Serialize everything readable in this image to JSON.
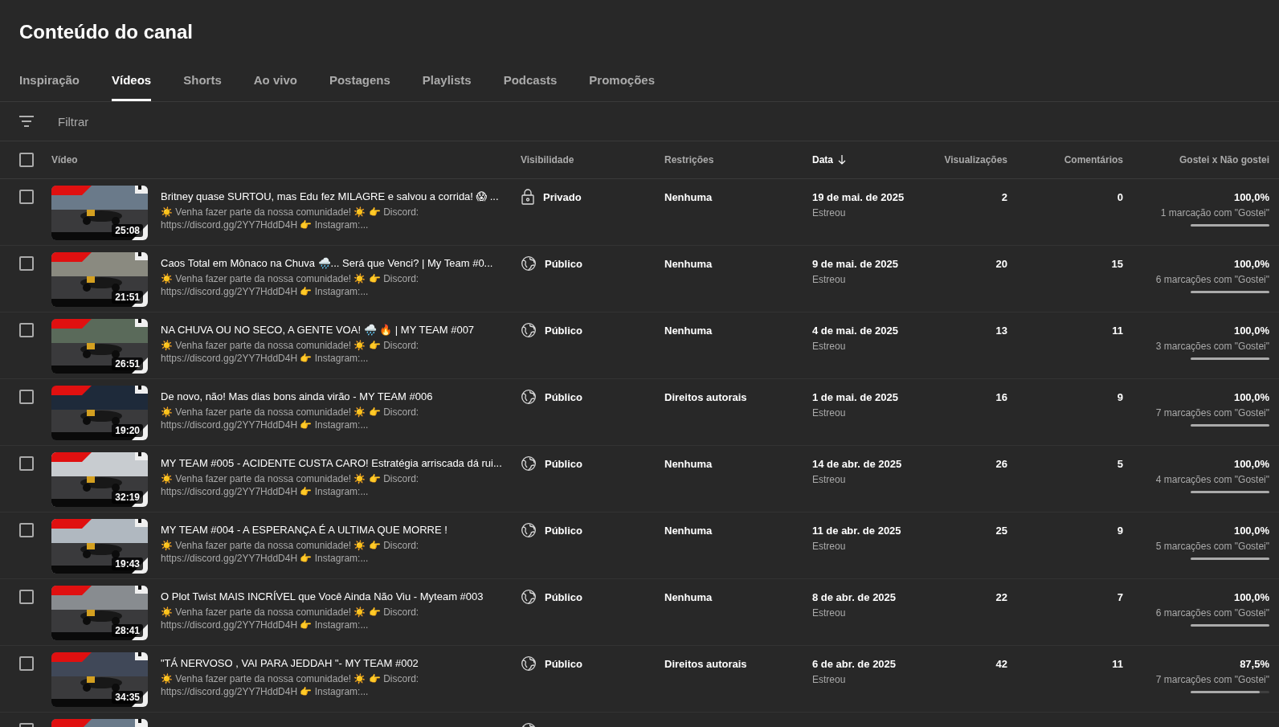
{
  "page_title": "Conteúdo do canal",
  "tabs": [
    {
      "label": "Inspiração",
      "selected": false
    },
    {
      "label": "Vídeos",
      "selected": true
    },
    {
      "label": "Shorts",
      "selected": false
    },
    {
      "label": "Ao vivo",
      "selected": false
    },
    {
      "label": "Postagens",
      "selected": false
    },
    {
      "label": "Playlists",
      "selected": false
    },
    {
      "label": "Podcasts",
      "selected": false
    },
    {
      "label": "Promoções",
      "selected": false
    }
  ],
  "filter": {
    "placeholder": "Filtrar"
  },
  "table": {
    "select_all_checked": false,
    "columns": [
      {
        "label": "Vídeo",
        "sorted": false
      },
      {
        "label": "Visibilidade",
        "sorted": false
      },
      {
        "label": "Restrições",
        "sorted": false
      },
      {
        "label": "Data",
        "sorted": true
      },
      {
        "label": "Visualizações",
        "sorted": false
      },
      {
        "label": "Comentários",
        "sorted": false
      },
      {
        "label": "Gostei x Não gostei",
        "sorted": false
      }
    ],
    "rows": [
      {
        "checked": false,
        "duration": "25:08",
        "title": "Britney quase SURTOU, mas Edu fez MILAGRE e salvou a corrida! 😱 ...",
        "description": "☀️ Venha fazer parte da nossa comunidade! ☀️ 👉 Discord: https://discord.gg/2YY7HddD4H 👉 Instagram:...",
        "visibility": {
          "kind": "private",
          "label": "Privado"
        },
        "restrictions": "Nenhuma",
        "date": "19 de mai. de 2025",
        "date_note": "Estreou",
        "views": "2",
        "comments": "0",
        "likes": {
          "percent": "100,0%",
          "count": "1 marcação com \"Gostei\"",
          "level": 1
        }
      },
      {
        "checked": false,
        "duration": "21:51",
        "title": "Caos Total em Mônaco na Chuva 🌧️... Será que Venci? | My Team #0...",
        "description": "☀️ Venha fazer parte da nossa comunidade! ☀️ 👉 Discord: https://discord.gg/2YY7HddD4H 👉 Instagram:...",
        "visibility": {
          "kind": "public",
          "label": "Público"
        },
        "restrictions": "Nenhuma",
        "date": "9 de mai. de 2025",
        "date_note": "Estreou",
        "views": "20",
        "comments": "15",
        "likes": {
          "percent": "100,0%",
          "count": "6 marcações com \"Gostei\"",
          "level": 1
        }
      },
      {
        "checked": false,
        "duration": "26:51",
        "title": "NA CHUVA OU NO SECO, A GENTE VOA! 🌧️ 🔥 | MY TEAM #007",
        "description": "☀️ Venha fazer parte da nossa comunidade! ☀️ 👉 Discord: https://discord.gg/2YY7HddD4H 👉 Instagram:...",
        "visibility": {
          "kind": "public",
          "label": "Público"
        },
        "restrictions": "Nenhuma",
        "date": "4 de mai. de 2025",
        "date_note": "Estreou",
        "views": "13",
        "comments": "11",
        "likes": {
          "percent": "100,0%",
          "count": "3 marcações com \"Gostei\"",
          "level": 1
        }
      },
      {
        "checked": false,
        "duration": "19:20",
        "title": "De novo, não! Mas dias bons ainda virão - MY TEAM #006",
        "description": "☀️ Venha fazer parte da nossa comunidade! ☀️ 👉 Discord: https://discord.gg/2YY7HddD4H 👉 Instagram:...",
        "visibility": {
          "kind": "public",
          "label": "Público"
        },
        "restrictions": "Direitos autorais",
        "date": "1 de mai. de 2025",
        "date_note": "Estreou",
        "views": "16",
        "comments": "9",
        "likes": {
          "percent": "100,0%",
          "count": "7 marcações com \"Gostei\"",
          "level": 1
        }
      },
      {
        "checked": false,
        "duration": "32:19",
        "title": "MY TEAM #005 - ACIDENTE CUSTA CARO! Estratégia arriscada dá rui...",
        "description": "☀️ Venha fazer parte da nossa comunidade! ☀️ 👉 Discord: https://discord.gg/2YY7HddD4H 👉 Instagram:...",
        "visibility": {
          "kind": "public",
          "label": "Público"
        },
        "restrictions": "Nenhuma",
        "date": "14 de abr. de 2025",
        "date_note": "Estreou",
        "views": "26",
        "comments": "5",
        "likes": {
          "percent": "100,0%",
          "count": "4 marcações com \"Gostei\"",
          "level": 1
        }
      },
      {
        "checked": false,
        "duration": "19:43",
        "title": "MY TEAM #004 - A ESPERANÇA É A ULTIMA QUE MORRE !",
        "description": "☀️ Venha fazer parte da nossa comunidade! ☀️ 👉 Discord: https://discord.gg/2YY7HddD4H 👉 Instagram:...",
        "visibility": {
          "kind": "public",
          "label": "Público"
        },
        "restrictions": "Nenhuma",
        "date": "11 de abr. de 2025",
        "date_note": "Estreou",
        "views": "25",
        "comments": "9",
        "likes": {
          "percent": "100,0%",
          "count": "5 marcações com \"Gostei\"",
          "level": 1
        }
      },
      {
        "checked": false,
        "duration": "28:41",
        "title": "O Plot Twist MAIS INCRÍVEL que Você Ainda Não Viu - Myteam #003",
        "description": "☀️ Venha fazer parte da nossa comunidade! ☀️ 👉 Discord: https://discord.gg/2YY7HddD4H 👉 Instagram:...",
        "visibility": {
          "kind": "public",
          "label": "Público"
        },
        "restrictions": "Nenhuma",
        "date": "8 de abr. de 2025",
        "date_note": "Estreou",
        "views": "22",
        "comments": "7",
        "likes": {
          "percent": "100,0%",
          "count": "6 marcações com \"Gostei\"",
          "level": 1
        }
      },
      {
        "checked": false,
        "duration": "34:35",
        "title": "\"TÁ NERVOSO , VAI PARA JEDDAH \"- MY TEAM #002",
        "description": "☀️ Venha fazer parte da nossa comunidade! ☀️ 👉 Discord: https://discord.gg/2YY7HddD4H 👉 Instagram:...",
        "visibility": {
          "kind": "public",
          "label": "Público"
        },
        "restrictions": "Direitos autorais",
        "date": "6 de abr. de 2025",
        "date_note": "Estreou",
        "views": "42",
        "comments": "11",
        "likes": {
          "percent": "87,5%",
          "count": "7 marcações com \"Gostei\"",
          "level": 0.875
        }
      },
      {
        "checked": false,
        "visibility": {
          "kind": "public"
        }
      }
    ]
  }
}
